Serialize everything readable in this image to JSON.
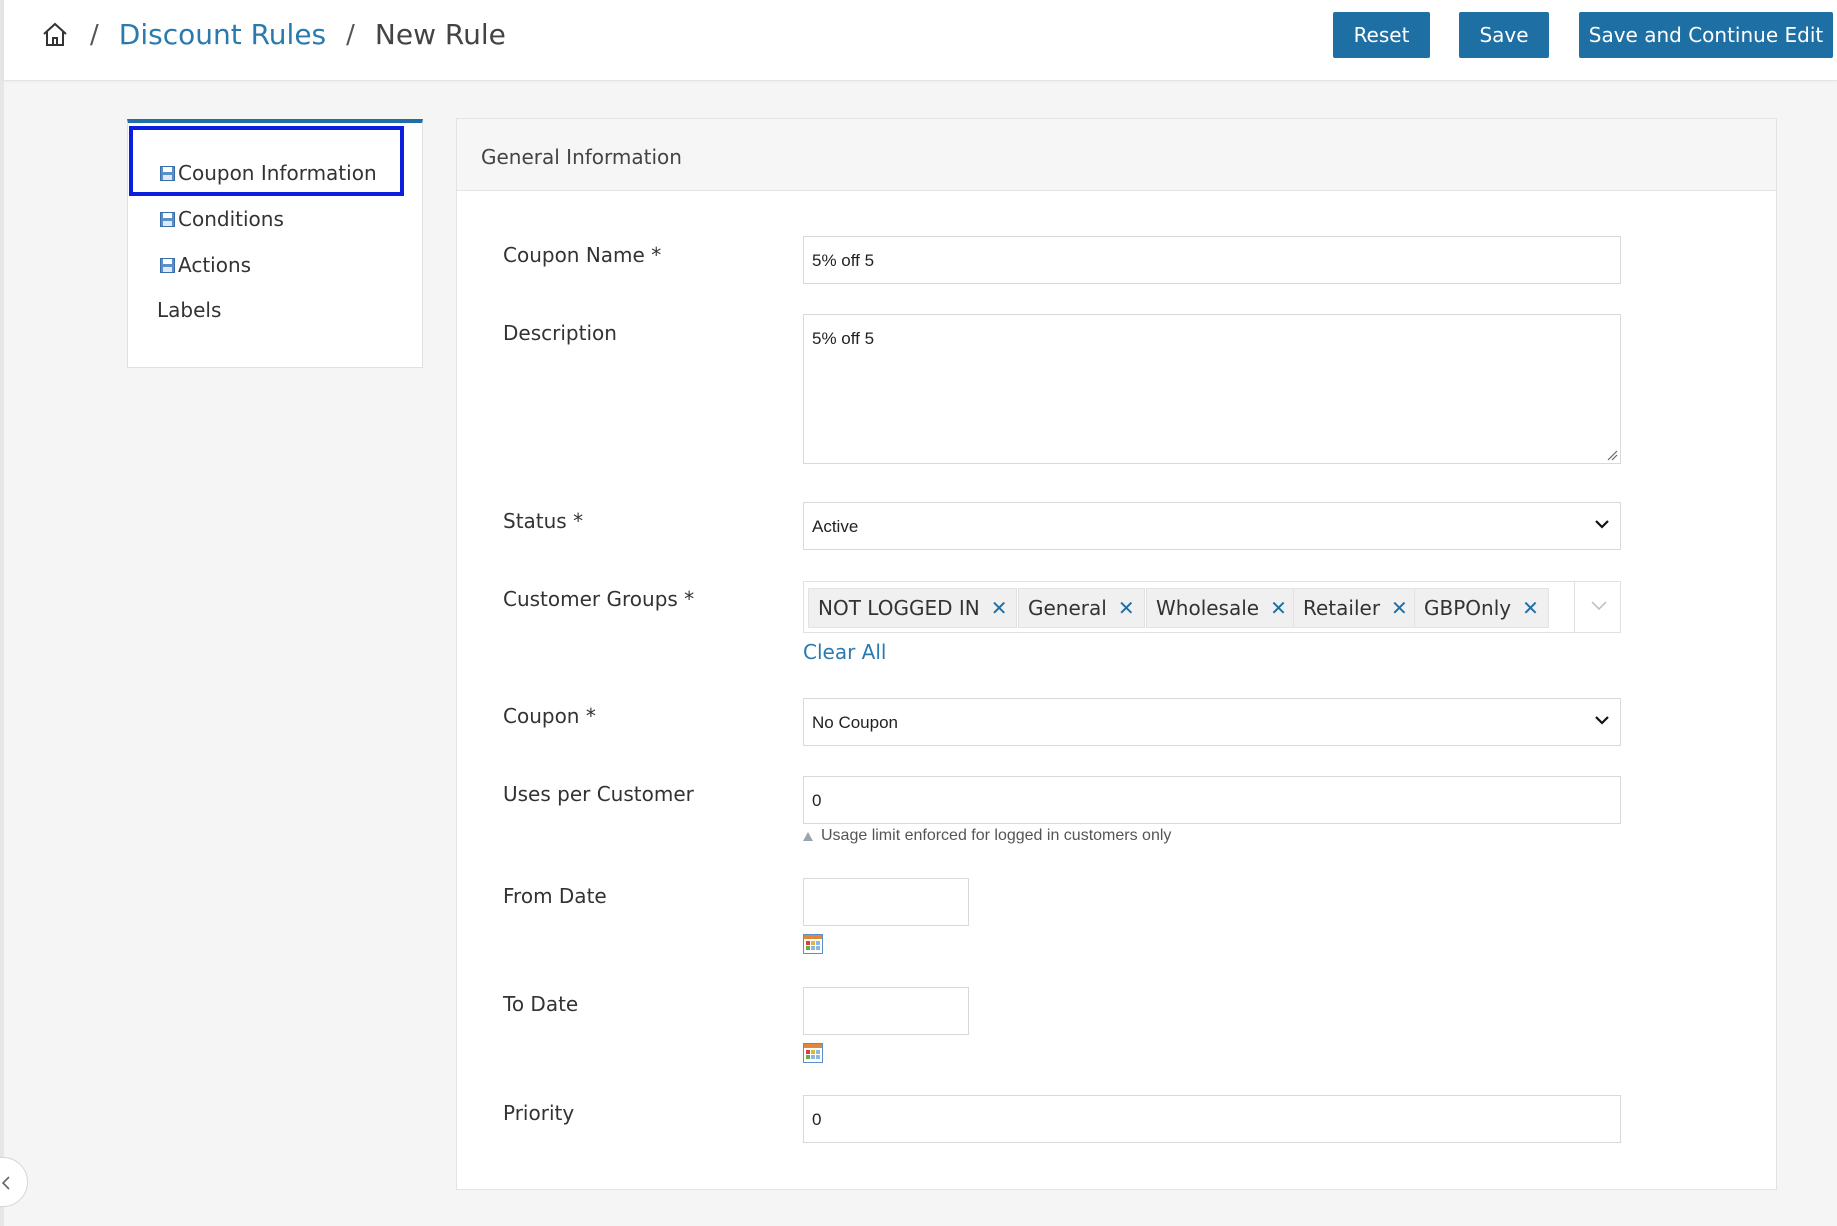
{
  "header": {
    "breadcrumb": {
      "home_icon": "home-icon",
      "separator": "/",
      "parent": "Discount Rules",
      "current": "New Rule"
    },
    "buttons": {
      "reset": "Reset",
      "save": "Save",
      "save_continue": "Save and Continue Edit"
    },
    "accent_color": "#1e70a4"
  },
  "tabs": {
    "items": [
      {
        "label": "Coupon Information",
        "icon": "save-icon",
        "active": true
      },
      {
        "label": "Conditions",
        "icon": "save-icon",
        "active": false
      },
      {
        "label": "Actions",
        "icon": "save-icon",
        "active": false
      },
      {
        "label": "Labels",
        "icon": "",
        "active": false
      }
    ]
  },
  "form": {
    "section_title": "General Information",
    "coupon_name": {
      "label": "Coupon Name *",
      "value": "5% off 5"
    },
    "description": {
      "label": "Description",
      "value": "5% off 5"
    },
    "status": {
      "label": "Status *",
      "value": "Active"
    },
    "customer_groups": {
      "label": "Customer Groups *",
      "chips": [
        "NOT LOGGED IN",
        "General",
        "Wholesale",
        "Retailer",
        "GBPOnly"
      ],
      "clear_all": "Clear All"
    },
    "coupon": {
      "label": "Coupon *",
      "value": "No Coupon"
    },
    "uses_per_customer": {
      "label": "Uses per Customer",
      "value": "0",
      "note": "Usage limit enforced for logged in customers only"
    },
    "from_date": {
      "label": "From Date",
      "value": ""
    },
    "to_date": {
      "label": "To Date",
      "value": ""
    },
    "priority": {
      "label": "Priority",
      "value": "0"
    }
  }
}
